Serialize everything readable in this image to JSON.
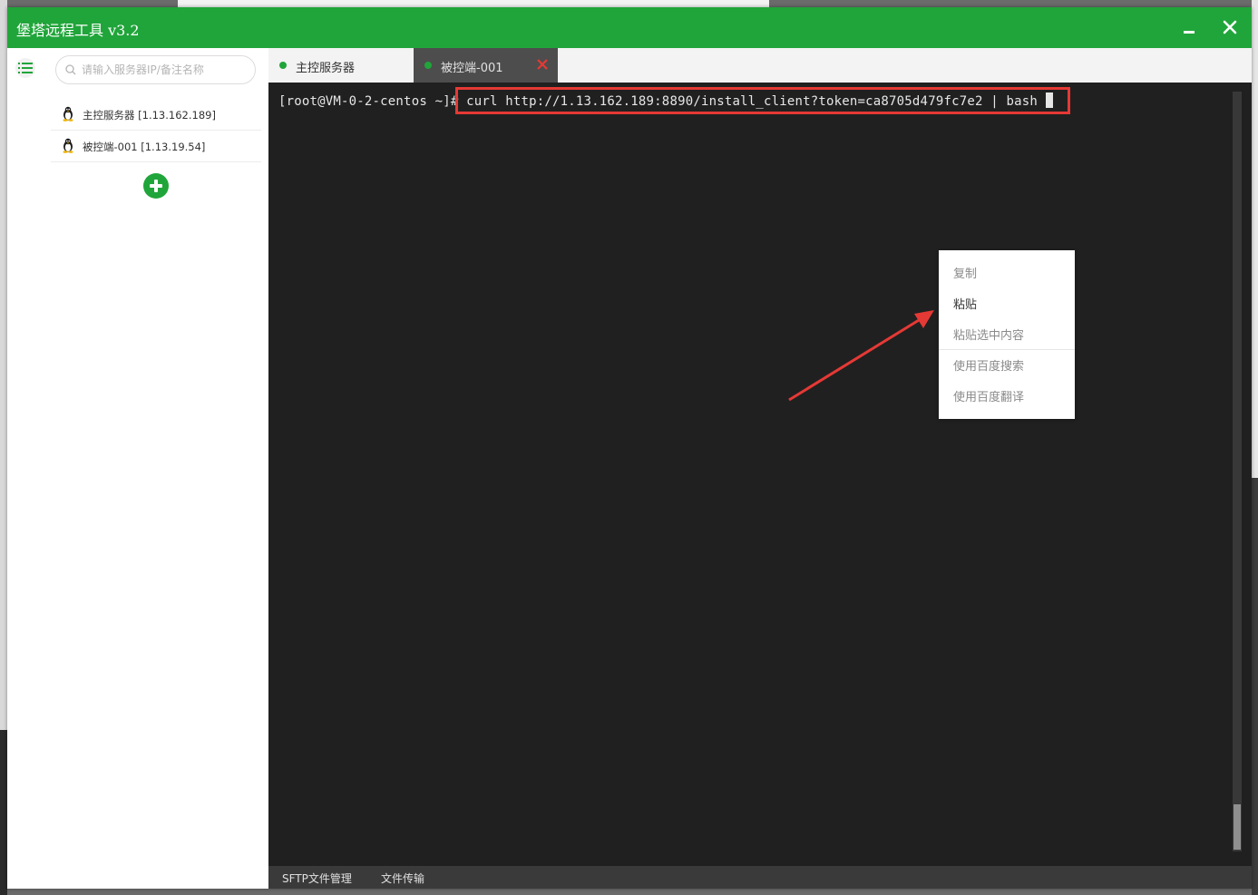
{
  "window": {
    "title": "堡塔远程工具 v3.2"
  },
  "sidebar": {
    "search_placeholder": "请输入服务器IP/备注名称",
    "servers": [
      {
        "name": "主控服务器 [1.13.162.189]"
      },
      {
        "name": "被控端-001 [1.13.19.54]"
      }
    ]
  },
  "tabs": [
    {
      "label": "主控服务器",
      "status_color": "#20a53a"
    },
    {
      "label": "被控端-001",
      "status_color": "#20a53a",
      "active": true
    }
  ],
  "terminal": {
    "prompt": "[root@VM-0-2-centos ~]# ",
    "command": "curl http://1.13.162.189:8890/install_client?token=ca8705d479fc7e2 | bash "
  },
  "context_menu": {
    "items": [
      {
        "label": "复制",
        "enabled": false
      },
      {
        "label": "粘贴",
        "enabled": true
      },
      {
        "label": "粘贴选中内容",
        "enabled": false
      },
      {
        "label": "使用百度搜索",
        "enabled": false
      },
      {
        "label": "使用百度翻译",
        "enabled": false
      }
    ]
  },
  "bottom_tabs": [
    {
      "label": "SFTP文件管理"
    },
    {
      "label": "文件传输"
    }
  ],
  "colors": {
    "brand_green": "#20a53a",
    "terminal_bg": "#202020",
    "highlight_red": "#e53935"
  },
  "icons": [
    "menu-list-icon",
    "search-icon",
    "linux-tux-icon",
    "add-icon",
    "close-icon",
    "minimize-icon",
    "arrow-annotation"
  ]
}
